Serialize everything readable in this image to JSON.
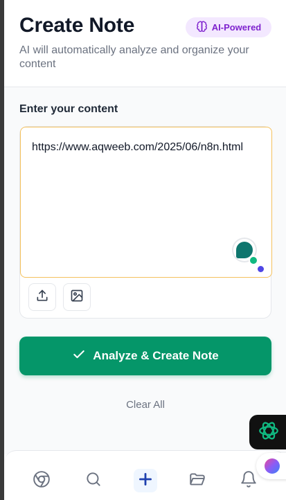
{
  "header": {
    "title": "Create Note",
    "badge": {
      "label": "AI-Powered",
      "icon": "brain-icon",
      "color": "#7e22ce"
    },
    "subtitle": "AI will automatically analyze and organize your content"
  },
  "content": {
    "section_label": "Enter your content",
    "input_value": "https://www.aqweeb.com/2025/06/n8n.html",
    "tools": [
      {
        "icon": "upload-icon"
      },
      {
        "icon": "image-icon"
      }
    ]
  },
  "actions": {
    "primary_label": "Analyze & Create Note",
    "primary_icon": "check-icon",
    "primary_color": "#059669",
    "clear_label": "Clear All"
  },
  "nav": {
    "items": [
      {
        "icon": "chrome-icon"
      },
      {
        "icon": "search-icon"
      },
      {
        "icon": "plus-icon",
        "active": true
      },
      {
        "icon": "folder-icon"
      },
      {
        "icon": "bell-icon"
      }
    ]
  },
  "floating": {
    "chatgpt_icon": "chatgpt-icon",
    "ai_icon": "ai-brain-icon"
  }
}
